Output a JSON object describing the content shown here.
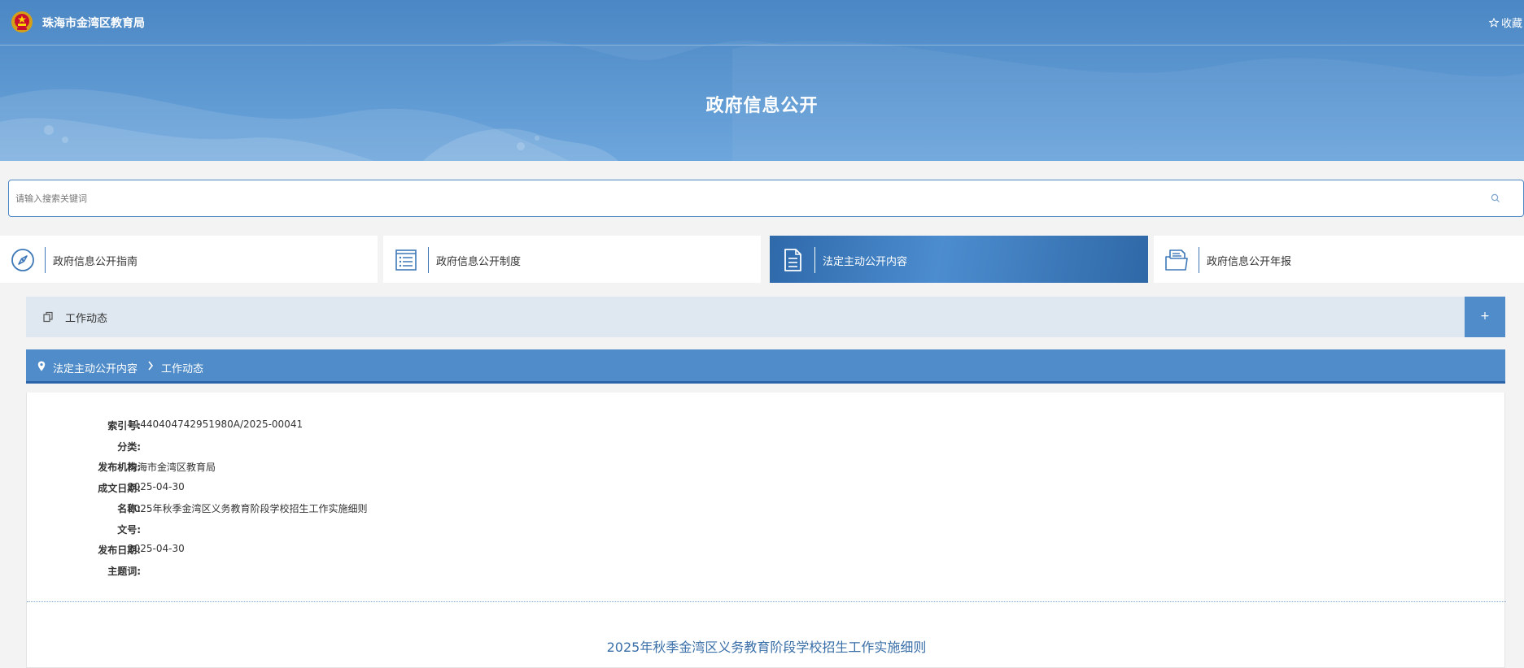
{
  "header": {
    "site_name": "珠海市金湾区教育局",
    "favorite_label": "收藏",
    "banner_title": "政府信息公开"
  },
  "search": {
    "placeholder": "请输入搜索关键词"
  },
  "tabs": [
    {
      "label": "政府信息公开指南",
      "icon": "compass-icon",
      "active": false
    },
    {
      "label": "政府信息公开制度",
      "icon": "list-icon",
      "active": false
    },
    {
      "label": "法定主动公开内容",
      "icon": "document-icon",
      "active": true
    },
    {
      "label": "政府信息公开年报",
      "icon": "folder-icon",
      "active": false
    }
  ],
  "section": {
    "label": "工作动态",
    "expand_label": "+"
  },
  "breadcrumb": {
    "items": [
      "法定主动公开内容",
      "工作动态"
    ]
  },
  "meta": [
    {
      "key": "索引号:",
      "value": "11440404742951980A/2025-00041"
    },
    {
      "key": "分类:",
      "value": ""
    },
    {
      "key": "发布机构:",
      "value": "珠海市金湾区教育局"
    },
    {
      "key": "成文日期:",
      "value": "2025-04-30"
    },
    {
      "key": "名称:",
      "value": "2025年秋季金湾区义务教育阶段学校招生工作实施细则"
    },
    {
      "key": "文号:",
      "value": ""
    },
    {
      "key": "发布日期:",
      "value": "2025-04-30"
    },
    {
      "key": "主题词:",
      "value": ""
    }
  ],
  "document": {
    "title": "2025年秋季金湾区义务教育阶段学校招生工作实施细则"
  },
  "colors": {
    "header_blue": "#4b87c4",
    "accent_blue": "#4f8cc9",
    "dark_blue": "#2b64a8",
    "section_bg": "#dfe8f0"
  }
}
